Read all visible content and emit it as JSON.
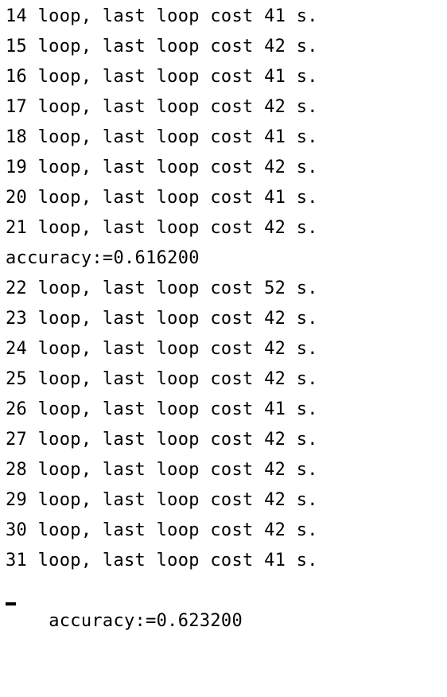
{
  "terminal": {
    "lines": [
      "14 loop, last loop cost 41 s.",
      "15 loop, last loop cost 42 s.",
      "16 loop, last loop cost 41 s.",
      "17 loop, last loop cost 42 s.",
      "18 loop, last loop cost 41 s.",
      "19 loop, last loop cost 42 s.",
      "20 loop, last loop cost 41 s.",
      "21 loop, last loop cost 42 s.",
      "accuracy:=0.616200",
      "22 loop, last loop cost 52 s.",
      "23 loop, last loop cost 42 s.",
      "24 loop, last loop cost 42 s.",
      "25 loop, last loop cost 42 s.",
      "26 loop, last loop cost 41 s.",
      "27 loop, last loop cost 42 s.",
      "28 loop, last loop cost 42 s.",
      "29 loop, last loop cost 42 s.",
      "30 loop, last loop cost 42 s.",
      "31 loop, last loop cost 41 s.",
      "accuracy:=0.623200"
    ]
  }
}
